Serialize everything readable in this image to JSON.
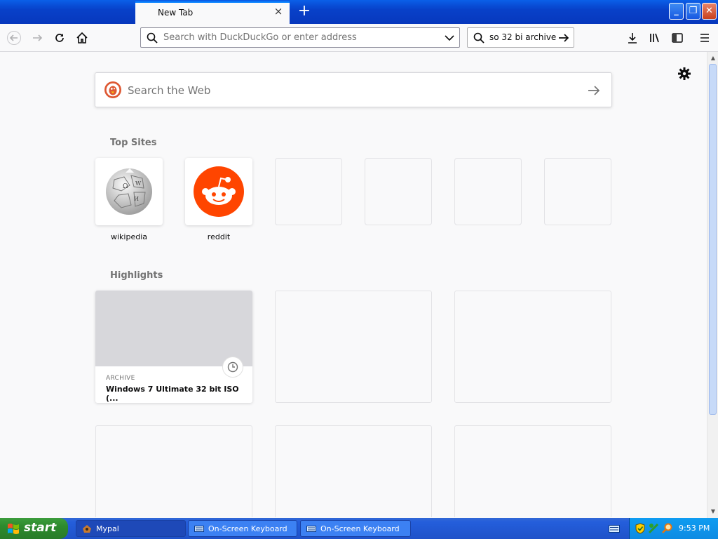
{
  "window": {
    "tab_title": "New Tab",
    "tab_close_glyph": "×",
    "new_tab_glyph": "+",
    "minimize_glyph": "_",
    "restore_glyph": "❐",
    "close_glyph": "✕"
  },
  "toolbar": {
    "url_placeholder": "Search with DuckDuckGo or enter address",
    "search_value": "so 32 bi archive"
  },
  "newtab": {
    "search_placeholder": "Search the Web",
    "top_sites_title": "Top Sites",
    "top_sites": [
      {
        "label": "wikipedia",
        "icon": "wikipedia-globe-icon"
      },
      {
        "label": "reddit",
        "icon": "reddit-alien-icon"
      }
    ],
    "highlights_title": "Highlights",
    "highlights": [
      {
        "context": "ARCHIVE",
        "title": "Windows 7 Ultimate 32 bit ISO (..."
      }
    ]
  },
  "taskbar": {
    "start_label": "start",
    "tasks": [
      {
        "label": "Mypal",
        "active": true
      },
      {
        "label": "On-Screen Keyboard",
        "active": false
      },
      {
        "label": "On-Screen Keyboard",
        "active": false
      }
    ],
    "clock": "9:53 PM"
  },
  "colors": {
    "accent": "#0a84ff",
    "reddit": "#ff4500",
    "titlebar": "#0841c9",
    "start_green": "#2d8a2d"
  }
}
